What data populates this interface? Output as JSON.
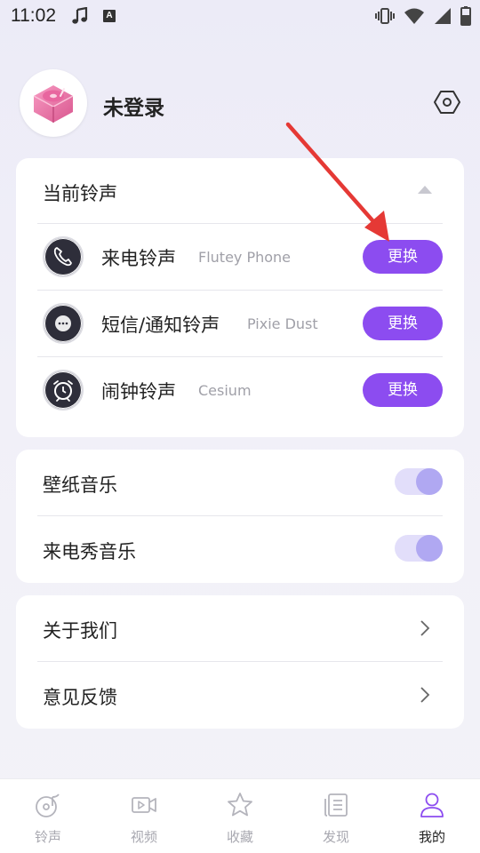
{
  "status_bar": {
    "time": "11:02",
    "badge_letter": "A",
    "icons": [
      "music-note-icon",
      "a-badge-icon",
      "vibrate-icon",
      "wifi-icon",
      "signal-icon",
      "battery-icon"
    ]
  },
  "profile": {
    "username": "未登录",
    "avatar_icon": "record-player-icon",
    "settings_icon": "settings-hexagon-icon"
  },
  "ringtone_card": {
    "title": "当前铃声",
    "collapse_icon": "chevron-up-icon",
    "items": [
      {
        "label": "来电铃声",
        "value": "Flutey Phone",
        "icon": "phone-icon",
        "button": "更换"
      },
      {
        "label": "短信/通知铃声",
        "value": "Pixie Dust",
        "icon": "message-icon",
        "button": "更换"
      },
      {
        "label": "闹钟铃声",
        "value": "Cesium",
        "icon": "alarm-clock-icon",
        "button": "更换"
      }
    ]
  },
  "music_card": {
    "items": [
      {
        "label": "壁纸音乐",
        "enabled": true
      },
      {
        "label": "来电秀音乐",
        "enabled": true
      }
    ]
  },
  "about_card": {
    "items": [
      {
        "label": "关于我们"
      },
      {
        "label": "意见反馈"
      }
    ]
  },
  "bottom_nav": {
    "items": [
      {
        "label": "铃声",
        "icon": "ringtone-disc-icon",
        "active": false
      },
      {
        "label": "视频",
        "icon": "video-icon",
        "active": false
      },
      {
        "label": "收藏",
        "icon": "star-icon",
        "active": false
      },
      {
        "label": "发现",
        "icon": "discover-list-icon",
        "active": false
      },
      {
        "label": "我的",
        "icon": "person-icon",
        "active": true
      }
    ]
  },
  "colors": {
    "accent": "#8c4cf0",
    "toggle_track": "#e2defa",
    "toggle_knob": "#b0a8f2",
    "annotation_arrow": "#e53935"
  }
}
